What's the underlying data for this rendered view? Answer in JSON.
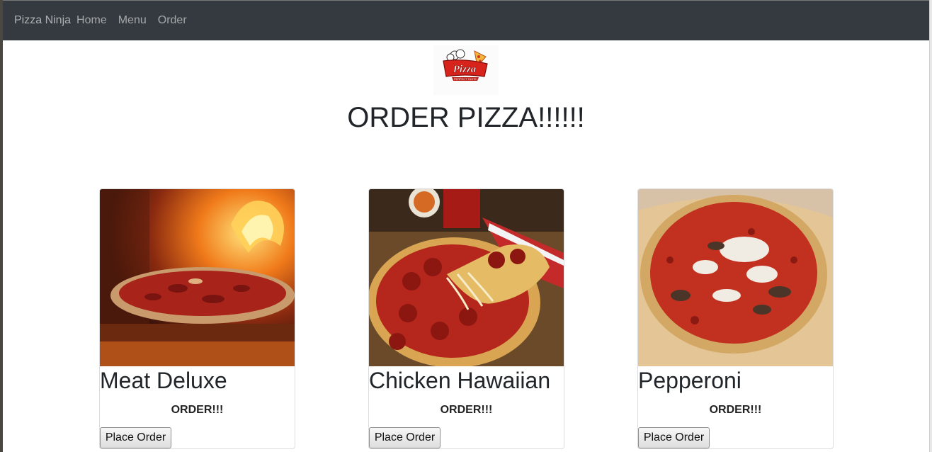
{
  "navbar": {
    "brand": "Pizza Ninja",
    "links": [
      "Home",
      "Menu",
      "Order"
    ]
  },
  "logo": {
    "text": "Pizza",
    "subtext": "PERFECT TASTE"
  },
  "page_title": "ORDER PIZZA!!!!!!",
  "cards": [
    {
      "title": "Meat Deluxe",
      "subtitle": "ORDER!!!",
      "button": "Place Order"
    },
    {
      "title": "Chicken Hawaiian",
      "subtitle": "ORDER!!!",
      "button": "Place Order"
    },
    {
      "title": "Pepperoni",
      "subtitle": "ORDER!!!",
      "button": "Place Order"
    }
  ],
  "colors": {
    "navbar": "#343a40",
    "nav_text": "#9a9da0",
    "page_bg": "#ffffff"
  }
}
